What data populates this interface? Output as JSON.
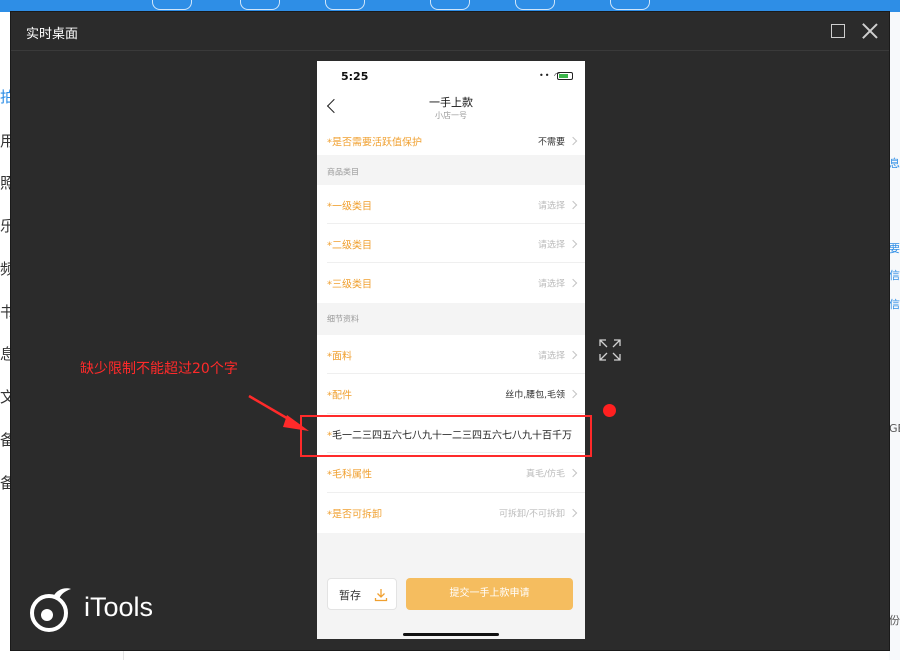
{
  "background_app": {
    "left_items": [
      "拍",
      "用",
      "照片",
      "乐",
      "频",
      "书",
      "息",
      "文件",
      "备",
      "备"
    ],
    "right_items": [
      "息",
      "要",
      "信",
      "信",
      "GB",
      "份"
    ]
  },
  "window": {
    "title": "实时桌面"
  },
  "phone": {
    "status_time": "5:25",
    "nav_title": "一手上款",
    "nav_subtitle": "小店一号",
    "rows": [
      {
        "label": "*是否需要活跃值保护",
        "value": "不需要"
      },
      {
        "label": "*一级类目",
        "value": "请选择"
      },
      {
        "label": "*二级类目",
        "value": "请选择"
      },
      {
        "label": "*三级类目",
        "value": "请选择"
      },
      {
        "label": "*面料",
        "value": "请选择"
      },
      {
        "label": "*配件",
        "value": "丝巾,腰包,毛领"
      },
      {
        "label": "*毛科属性",
        "value": "真毛/仿毛"
      },
      {
        "label": "*是否可拆卸",
        "value": "可拆卸/不可拆卸"
      }
    ],
    "section_goods": "商品类目",
    "section_detail": "细节资料",
    "long_field": {
      "star": "*",
      "text": "毛一二三四五六七八九十一二三四五六七八九十百千万"
    },
    "save_label": "暂存",
    "submit_label": "提交一手上款申请"
  },
  "annotation": {
    "text": "缺少限制不能超过20个字",
    "color": "#ff2a2a"
  },
  "brand": {
    "name": "iTools"
  },
  "colors": {
    "accent_orange": "#f0a030",
    "submit_bg": "#f5bd5f",
    "window_bg": "#2b2b2b",
    "app_blue": "#2e8ee6"
  }
}
